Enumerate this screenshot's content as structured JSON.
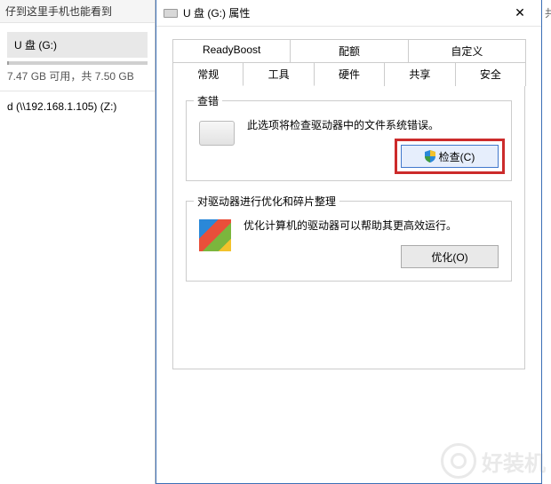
{
  "leftPanel": {
    "headerText": "仔到这里手机也能看到",
    "drives": [
      {
        "label": "U 盘 (G:)",
        "info": "7.47 GB 可用，共 7.50 GB"
      },
      {
        "label": "d (\\\\192.168.1.105) (Z:)"
      }
    ]
  },
  "dialog": {
    "icon": "drive-icon",
    "title": "U 盘 (G:) 属性",
    "closeText": "✕",
    "edgeText": "共",
    "tabsRow1": [
      "ReadyBoost",
      "配额",
      "自定义"
    ],
    "tabsRow2": [
      "常规",
      "工具",
      "硬件",
      "共享",
      "安全"
    ],
    "activeTab": "工具",
    "sections": {
      "check": {
        "title": "查错",
        "text": "此选项将检查驱动器中的文件系统错误。",
        "buttonLabel": "检查(C)"
      },
      "optimize": {
        "title": "对驱动器进行优化和碎片整理",
        "text": "优化计算机的驱动器可以帮助其更高效运行。",
        "buttonLabel": "优化(O)"
      }
    }
  },
  "watermark": "好装机"
}
